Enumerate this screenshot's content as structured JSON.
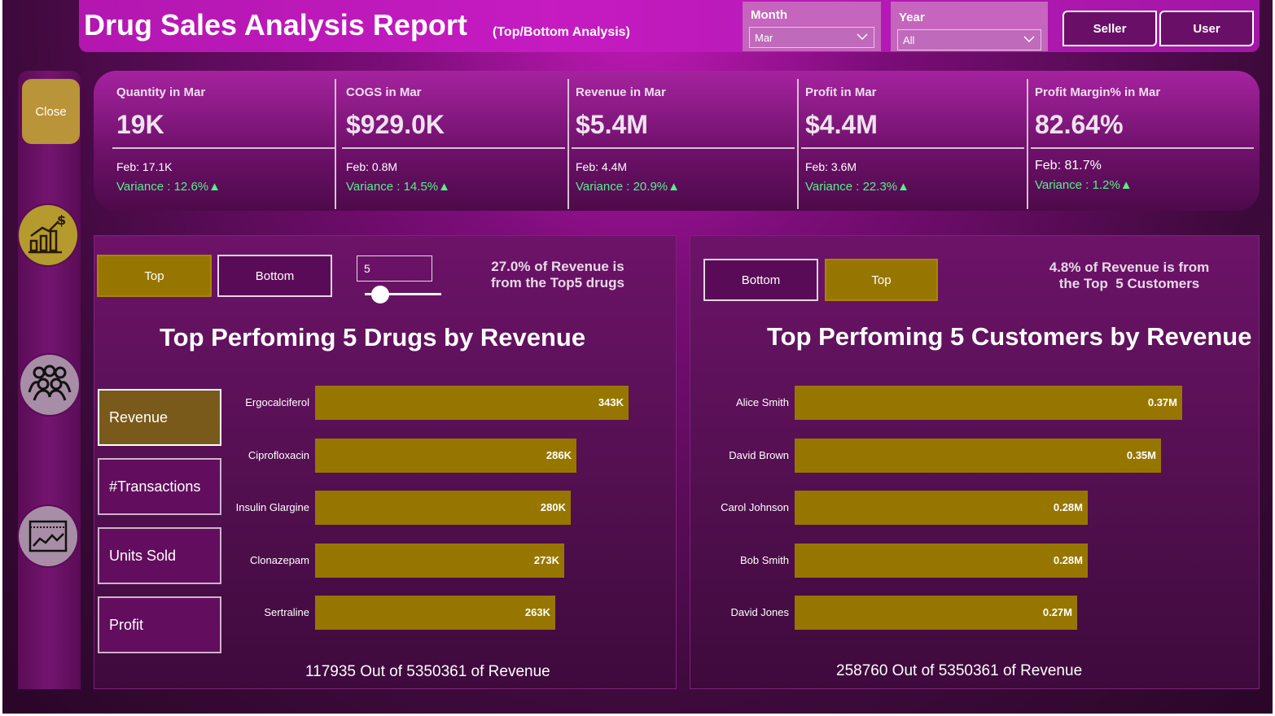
{
  "header": {
    "title": "Drug Sales Analysis Report",
    "subtitle": "(Top/Bottom Analysis)",
    "month": {
      "label": "Month",
      "value": "Mar"
    },
    "year": {
      "label": "Year",
      "value": "All"
    },
    "seller_label": "Seller",
    "user_label": "User"
  },
  "sidebar": {
    "close_label": "Close",
    "icons": [
      "finance-chart-icon",
      "customers-group-icon",
      "line-chart-window-icon"
    ]
  },
  "kpis": [
    {
      "title": "Quantity in Mar",
      "value": "19K",
      "feb": "Feb: 17.1K",
      "variance": "Variance : 12.6%▲"
    },
    {
      "title": "COGS in Mar",
      "value": "$929.0K",
      "feb": "Feb: 0.8M",
      "variance": "Variance : 14.5%▲"
    },
    {
      "title": "Revenue in Mar",
      "value": "$5.4M",
      "feb": "Feb: 4.4M",
      "variance": "Variance : 20.9%▲"
    },
    {
      "title": "Profit in Mar",
      "value": "$4.4M",
      "feb": "Feb: 3.6M",
      "variance": "Variance : 22.3%▲"
    },
    {
      "title": "Profit Margin% in Mar",
      "value": "82.64%",
      "feb": "Feb: 81.7%",
      "variance": "Variance : 1.2%▲"
    }
  ],
  "left_panel": {
    "top_label": "Top",
    "bottom_label": "Bottom",
    "topn_value": "5",
    "topn_slider_fraction": 0.2,
    "note": "27.0% of Revenue is\nfrom the Top5 drugs",
    "title": "Top Perfoming 5 Drugs by  Revenue",
    "measures": [
      "Revenue",
      "#Transactions",
      "Units Sold",
      "Profit"
    ],
    "selected_measure": "Revenue",
    "footer": "117935 Out of 5350361 of  Revenue"
  },
  "right_panel": {
    "bottom_label": "Bottom",
    "top_label": "Top",
    "note": "4.8% of Revenue is from\nthe Top  5 Customers",
    "title": "Top Perfoming 5 Customers by  Revenue",
    "footer": "258760 Out of 5350361 of  Revenue"
  },
  "chart_data": [
    {
      "type": "bar",
      "orientation": "horizontal",
      "title": "Top Perfoming 5 Drugs by  Revenue",
      "categories": [
        "Ergocalciferol",
        "Ciprofloxacin",
        "Insulin Glargine",
        "Clonazepam",
        "Sertraline"
      ],
      "values": [
        343000,
        286000,
        280000,
        273000,
        263000
      ],
      "labels": [
        "343K",
        "286K",
        "280K",
        "273K",
        "263K"
      ],
      "color": "#977600"
    },
    {
      "type": "bar",
      "orientation": "horizontal",
      "title": "Top Perfoming 5 Customers by  Revenue",
      "categories": [
        "Alice Smith",
        "David Brown",
        "Carol Johnson",
        "Bob Smith",
        "David Jones"
      ],
      "values": [
        370000,
        350000,
        280000,
        280000,
        270000
      ],
      "labels": [
        "0.37M",
        "0.35M",
        "0.28M",
        "0.28M",
        "0.27M"
      ],
      "color": "#977600"
    }
  ]
}
